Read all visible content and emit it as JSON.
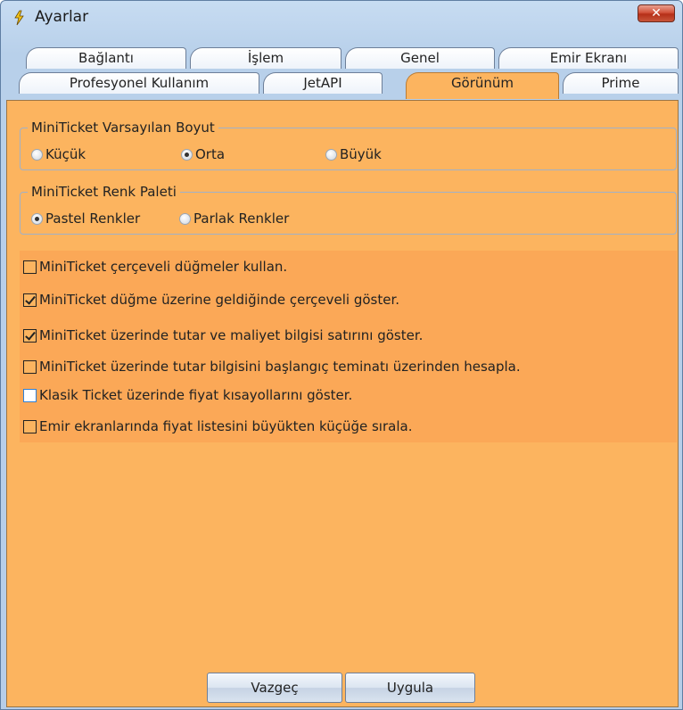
{
  "window": {
    "title": "Ayarlar",
    "close_glyph": "✕"
  },
  "tabs_row1": [
    "Bağlantı",
    "İşlem",
    "Genel",
    "Emir Ekranı"
  ],
  "tabs_row2": [
    "Profesyonel Kullanım",
    "JetAPI",
    "Görünüm",
    "Prime"
  ],
  "active_tab": "Görünüm",
  "size_group": {
    "legend": "MiniTicket Varsayılan Boyut",
    "options": [
      "Küçük",
      "Orta",
      "Büyük"
    ],
    "selected": "Orta"
  },
  "palette_group": {
    "legend": "MiniTicket Renk Paleti",
    "options": [
      "Pastel Renkler",
      "Parlak Renkler"
    ],
    "selected": "Pastel Renkler"
  },
  "checkboxes": [
    {
      "label": "MiniTicket çerçeveli düğmeler kullan.",
      "checked": false
    },
    {
      "label": "MiniTicket düğme üzerine geldiğinde çerçeveli göster.",
      "checked": true
    },
    {
      "label": "MiniTicket üzerinde tutar ve maliyet bilgisi satırını göster.",
      "checked": true
    },
    {
      "label": "MiniTicket üzerinde tutar bilgisini başlangıç teminatı üzerinden hesapla.",
      "checked": false
    },
    {
      "label": "Klasik Ticket üzerinde fiyat kısayollarını göster.",
      "checked": false
    },
    {
      "label": "Emir ekranlarında fiyat listesini büyükten küçüğe sırala.",
      "checked": false
    }
  ],
  "buttons": {
    "cancel": "Vazgeç",
    "apply": "Uygula"
  },
  "colors": {
    "panel": "#fcb45f",
    "titlebar": "#c7dcf2",
    "close": "#c8553a"
  }
}
